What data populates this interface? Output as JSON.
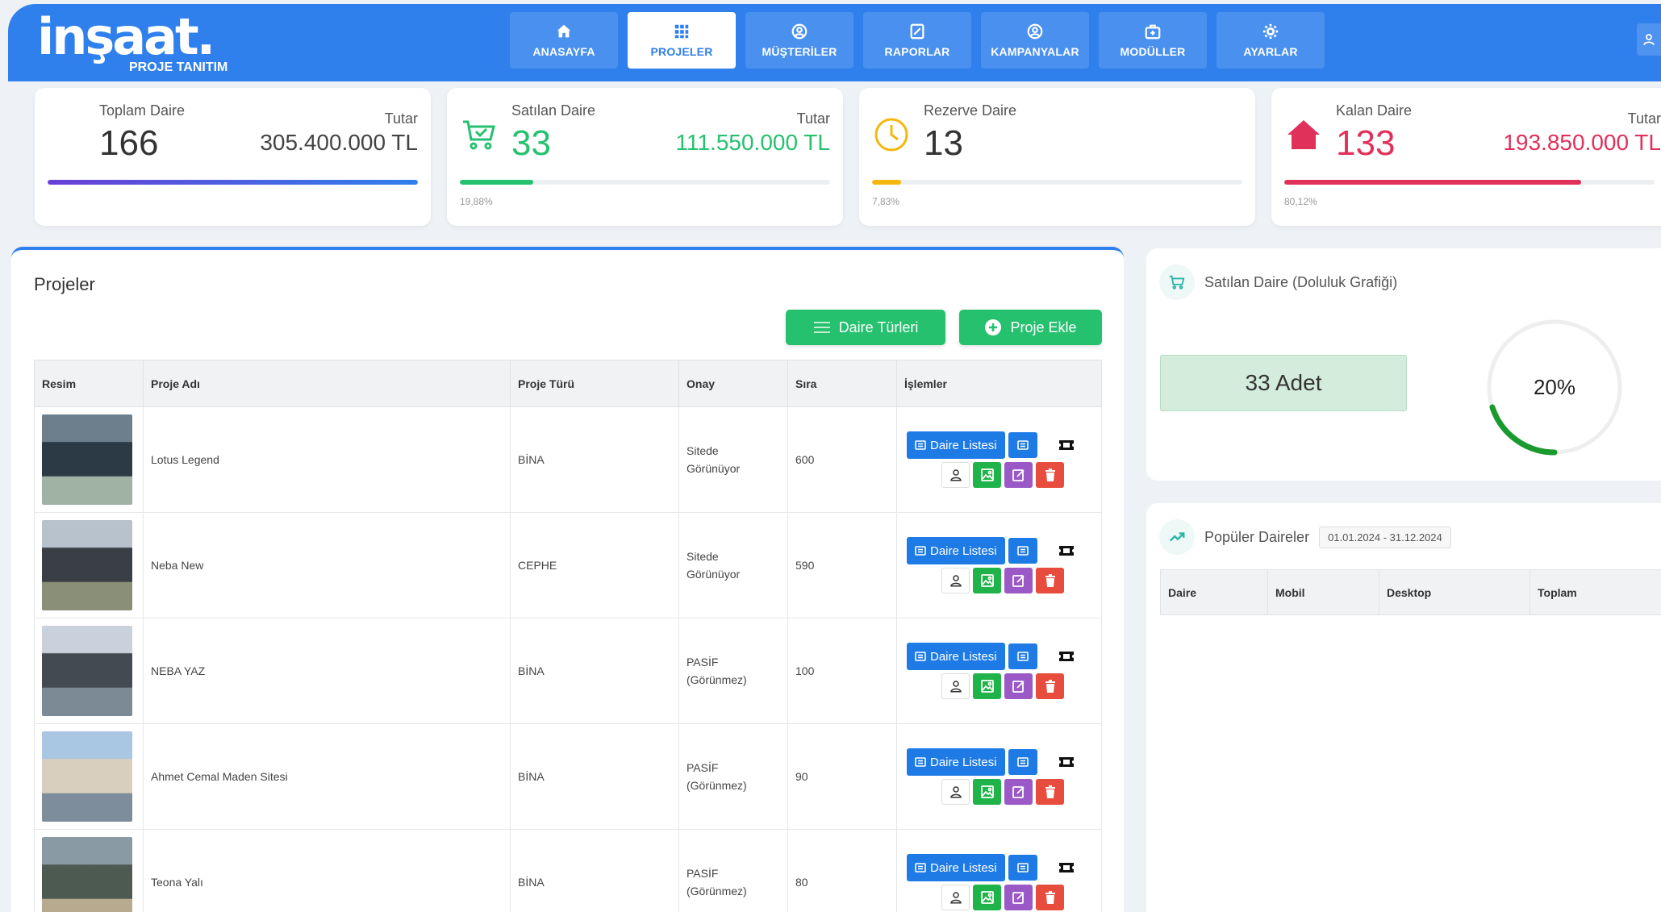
{
  "brand": {
    "name": "inşaat.",
    "sub": "PROJE TANITIM"
  },
  "nav": [
    {
      "label": "ANASAYFA",
      "icon": "home-icon",
      "active": false
    },
    {
      "label": "PROJELER",
      "icon": "grid-icon",
      "active": true
    },
    {
      "label": "MÜŞTERİLER",
      "icon": "user-circle-icon",
      "active": false
    },
    {
      "label": "RAPORLAR",
      "icon": "edit-note-icon",
      "active": false
    },
    {
      "label": "KAMPANYALAR",
      "icon": "user-circle-icon",
      "active": false
    },
    {
      "label": "MODÜLLER",
      "icon": "medkit-icon",
      "active": false
    },
    {
      "label": "AYARLAR",
      "icon": "gear-icon",
      "active": false
    }
  ],
  "stats": {
    "total": {
      "label": "Toplam Daire",
      "value": "166",
      "amount_label": "Tutar",
      "amount": "305.400.000 TL",
      "progress": 1.0
    },
    "sold": {
      "label": "Satılan Daire",
      "value": "33",
      "amount_label": "Tutar",
      "amount": "111.550.000 TL",
      "percent": "19,88%",
      "progress": 0.1988,
      "color": "#25c16f"
    },
    "reserved": {
      "label": "Rezerve Daire",
      "value": "13",
      "percent": "7,83%",
      "progress": 0.0783,
      "color": "#f5b70f"
    },
    "remaining": {
      "label": "Kalan Daire",
      "value": "133",
      "amount_label": "Tutar",
      "amount": "193.850.000 TL",
      "percent": "80,12%",
      "progress": 0.8012,
      "color": "#e0315a"
    }
  },
  "projects": {
    "title": "Projeler",
    "buttons": {
      "types": "Daire Türleri",
      "add": "Proje Ekle"
    },
    "columns": [
      "Resim",
      "Proje Adı",
      "Proje Türü",
      "Onay",
      "Sıra",
      "İşlemler"
    ],
    "action_label": "Daire Listesi",
    "rows": [
      {
        "name": "Lotus Legend",
        "type": "BİNA",
        "onay1": "Sitede",
        "onay2": "Görünüyor",
        "order": "600"
      },
      {
        "name": "Neba New",
        "type": "CEPHE",
        "onay1": "Sitede",
        "onay2": "Görünüyor",
        "order": "590"
      },
      {
        "name": "NEBA YAZ",
        "type": "BİNA",
        "onay1": "PASİF",
        "onay2": "(Görünmez)",
        "order": "100"
      },
      {
        "name": "Ahmet Cemal Maden Sitesi",
        "type": "BİNA",
        "onay1": "PASİF",
        "onay2": "(Görünmez)",
        "order": "90"
      },
      {
        "name": "Teona Yalı",
        "type": "BİNA",
        "onay1": "PASİF",
        "onay2": "(Görünmez)",
        "order": "80"
      }
    ]
  },
  "gauge": {
    "title": "Satılan Daire (Doluluk Grafiği)",
    "count": "33 Adet",
    "percent": "20%",
    "progress": 0.2
  },
  "popular": {
    "title": "Popüler Daireler",
    "date_range": "01.01.2024 - 31.12.2024",
    "columns": [
      "Daire",
      "Mobil",
      "Desktop",
      "Toplam"
    ]
  },
  "colors": {
    "primary": "#2f80ed",
    "success": "#25c16f",
    "gauge": "#1a9a2e"
  }
}
